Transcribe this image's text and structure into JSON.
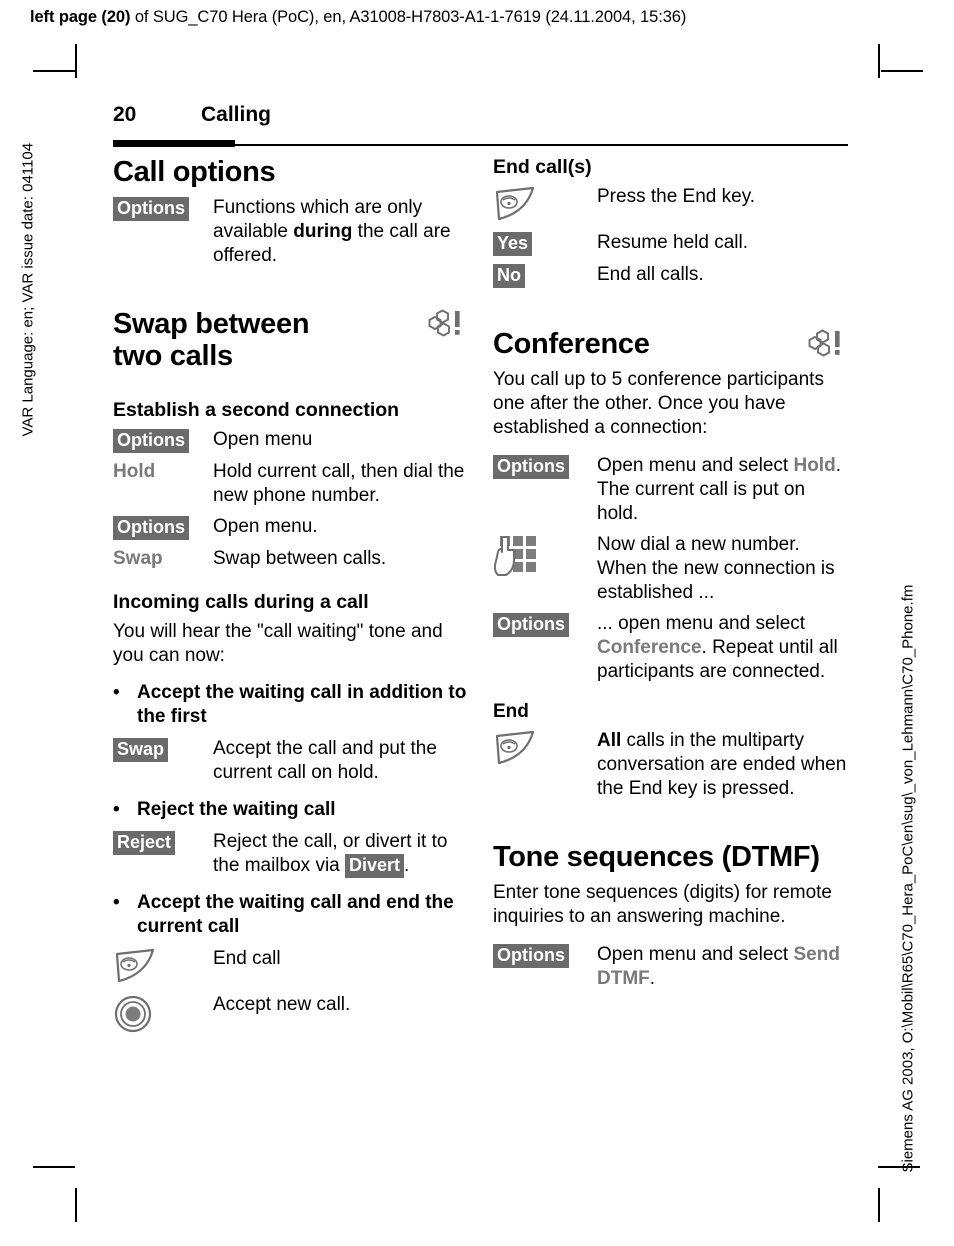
{
  "print_header": {
    "bold_part": "left page (20)",
    "rest": " of SUG_C70 Hera (PoC), en, A31008-H7803-A1-1-7619 (24.11.2004, 15:36)"
  },
  "margins": {
    "left": "VAR Language: en; VAR issue date: 041104",
    "right": "Siemens AG 2003, O:\\Mobil\\R65\\C70_Hera_PoC\\en\\sug\\_von_Lehmann\\C70_Phone.fm"
  },
  "running_head": {
    "page_number": "20",
    "chapter": "Calling"
  },
  "left_column": {
    "call_options": {
      "heading": "Call options",
      "rows": [
        {
          "key_badge": "Options",
          "desc_pre": "Functions which are only available ",
          "desc_bold": "during",
          "desc_post": " the call are offered."
        }
      ]
    },
    "swap": {
      "heading_line1": "Swap between",
      "heading_line2": "two calls",
      "network_icon": "network-dependent-icon",
      "sub_establish": "Establish a second connection",
      "rows": [
        {
          "key_badge": "Options",
          "desc": "Open menu"
        },
        {
          "key_menu": "Hold",
          "desc": "Hold current call, then dial the new phone number."
        },
        {
          "key_badge": "Options",
          "desc": "Open menu."
        },
        {
          "key_menu": "Swap",
          "desc": "Swap between calls."
        }
      ]
    },
    "incoming": {
      "sub": "Incoming calls during a call",
      "intro": "You will hear the \"call waiting\" tone and you can now:",
      "bullets": [
        {
          "text": "Accept the waiting call in addition to the first",
          "rows": [
            {
              "key_badge": "Swap",
              "desc": "Accept the call and put the current call on hold."
            }
          ]
        },
        {
          "text": "Reject the waiting call",
          "rows": [
            {
              "key_badge": "Reject",
              "desc_pre": "Reject the call, or divert it to the mailbox via ",
              "inline_badge": "Divert",
              "desc_post": "."
            }
          ]
        },
        {
          "text": "Accept the waiting call and end the current call",
          "rows": [
            {
              "key_icon": "end-key-icon",
              "desc": "End call"
            },
            {
              "key_icon": "ok-key-icon",
              "desc": "Accept new call."
            }
          ]
        }
      ]
    }
  },
  "right_column": {
    "end_calls": {
      "sub": "End call(s)",
      "rows": [
        {
          "key_icon": "end-key-icon",
          "desc": "Press the End key."
        },
        {
          "key_badge": "Yes",
          "desc": "Resume held call."
        },
        {
          "key_badge": "No",
          "desc": "End all calls."
        }
      ]
    },
    "conference": {
      "heading": "Conference",
      "network_icon": "network-dependent-icon",
      "intro": "You call up to 5 conference participants one after the other. Once you have established a connection:",
      "rows": [
        {
          "key_badge": "Options",
          "desc_pre": "Open menu and select ",
          "menu_item": "Hold",
          "desc_post": ". The current call is put on hold."
        },
        {
          "key_icon": "keypad-icon",
          "desc": "Now dial a new number. When the new connection is established ..."
        },
        {
          "key_badge": "Options",
          "desc_pre": "... open menu and select ",
          "menu_item": "Conference",
          "desc_post": ". Repeat until all participants are connected."
        }
      ],
      "end_label": "End",
      "end_row": {
        "key_icon": "end-key-icon",
        "desc_bold": "All",
        "desc_post": " calls in the multiparty conversation are ended when the End key is pressed."
      }
    },
    "dtmf": {
      "heading": "Tone sequences (DTMF)",
      "intro": "Enter tone sequences (digits) for remote inquiries to an answering machine.",
      "rows": [
        {
          "key_badge": "Options",
          "desc_pre": "Open menu and select ",
          "menu_item": "Send DTMF",
          "desc_post": "."
        }
      ]
    }
  },
  "colors": {
    "badge_bg": "#6b6b6b",
    "badge_fg": "#ffffff",
    "menu_item_fg": "#7a7a7a",
    "icon_stroke": "#6f6f6f",
    "text": "#000000"
  }
}
